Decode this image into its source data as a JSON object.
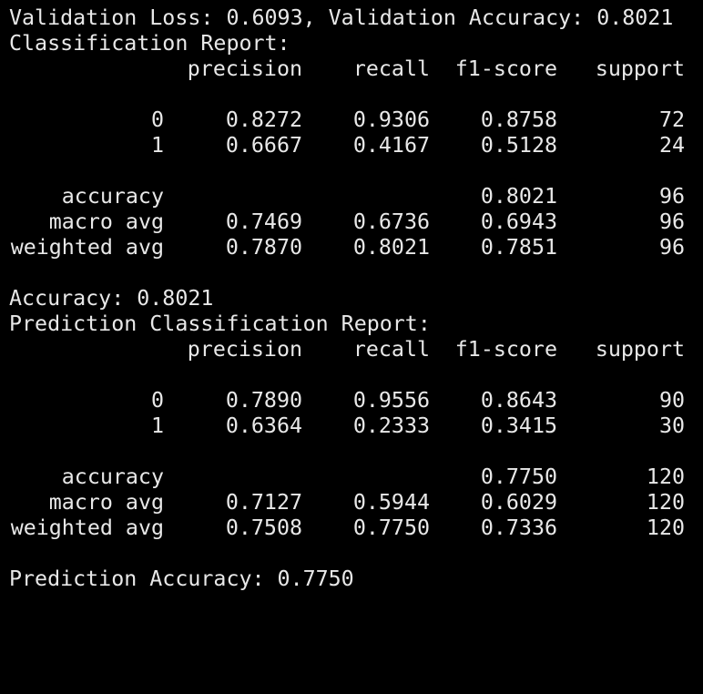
{
  "top_partial": "",
  "validation_line": "Validation Loss: 0.6093, Validation Accuracy: 0.8021",
  "report1": {
    "title": "Classification Report:",
    "headers": [
      "precision",
      "recall",
      "f1-score",
      "support"
    ],
    "class_rows": [
      {
        "label": "0",
        "precision": "0.8272",
        "recall": "0.9306",
        "f1": "0.8758",
        "support": "72"
      },
      {
        "label": "1",
        "precision": "0.6667",
        "recall": "0.4167",
        "f1": "0.5128",
        "support": "24"
      }
    ],
    "accuracy_row": {
      "label": "accuracy",
      "f1": "0.8021",
      "support": "96"
    },
    "macro_row": {
      "label": "macro avg",
      "precision": "0.7469",
      "recall": "0.6736",
      "f1": "0.6943",
      "support": "96"
    },
    "weighted_row": {
      "label": "weighted avg",
      "precision": "0.7870",
      "recall": "0.8021",
      "f1": "0.7851",
      "support": "96"
    },
    "accuracy_line": "Accuracy: 0.8021"
  },
  "report2": {
    "title": "Prediction Classification Report:",
    "headers": [
      "precision",
      "recall",
      "f1-score",
      "support"
    ],
    "class_rows": [
      {
        "label": "0",
        "precision": "0.7890",
        "recall": "0.9556",
        "f1": "0.8643",
        "support": "90"
      },
      {
        "label": "1",
        "precision": "0.6364",
        "recall": "0.2333",
        "f1": "0.3415",
        "support": "30"
      }
    ],
    "accuracy_row": {
      "label": "accuracy",
      "f1": "0.7750",
      "support": "120"
    },
    "macro_row": {
      "label": "macro avg",
      "precision": "0.7127",
      "recall": "0.5944",
      "f1": "0.6029",
      "support": "120"
    },
    "weighted_row": {
      "label": "weighted avg",
      "precision": "0.7508",
      "recall": "0.7750",
      "f1": "0.7336",
      "support": "120"
    },
    "accuracy_line": "Prediction Accuracy: 0.7750"
  },
  "colors": {
    "background": "#000000",
    "text": "#e8e8e8"
  }
}
